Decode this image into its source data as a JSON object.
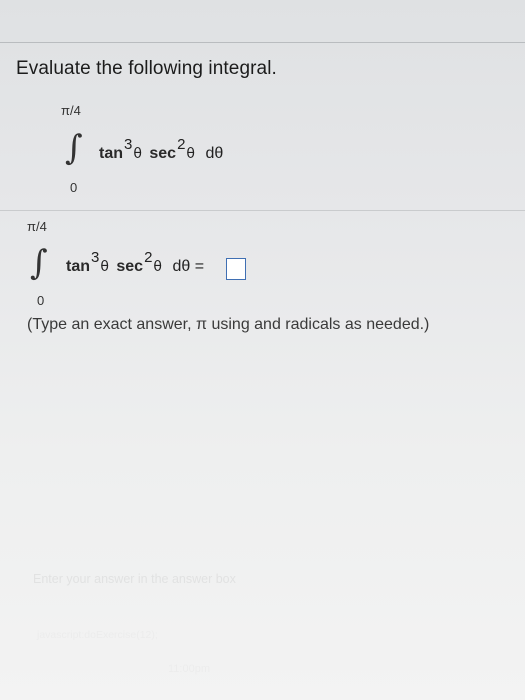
{
  "question": {
    "title": "Evaluate the following integral."
  },
  "integral_display": {
    "upper_limit": "π/4",
    "lower_limit": "0",
    "tan": "tan",
    "tan_power": "3",
    "sec": "sec",
    "sec_power": "2",
    "theta": "θ",
    "differential": "dθ"
  },
  "answer_row": {
    "upper_limit": "π/4",
    "lower_limit": "0",
    "tan": "tan",
    "tan_power": "3",
    "sec": "sec",
    "sec_power": "2",
    "theta": "θ",
    "differential_eq": "dθ ="
  },
  "instruction": "(Type an exact answer, π using and radicals as needed.)",
  "hint": "Enter your answer in the answer box",
  "status_bar": "javascript:doExercise(12);",
  "clock": "11:00pm"
}
